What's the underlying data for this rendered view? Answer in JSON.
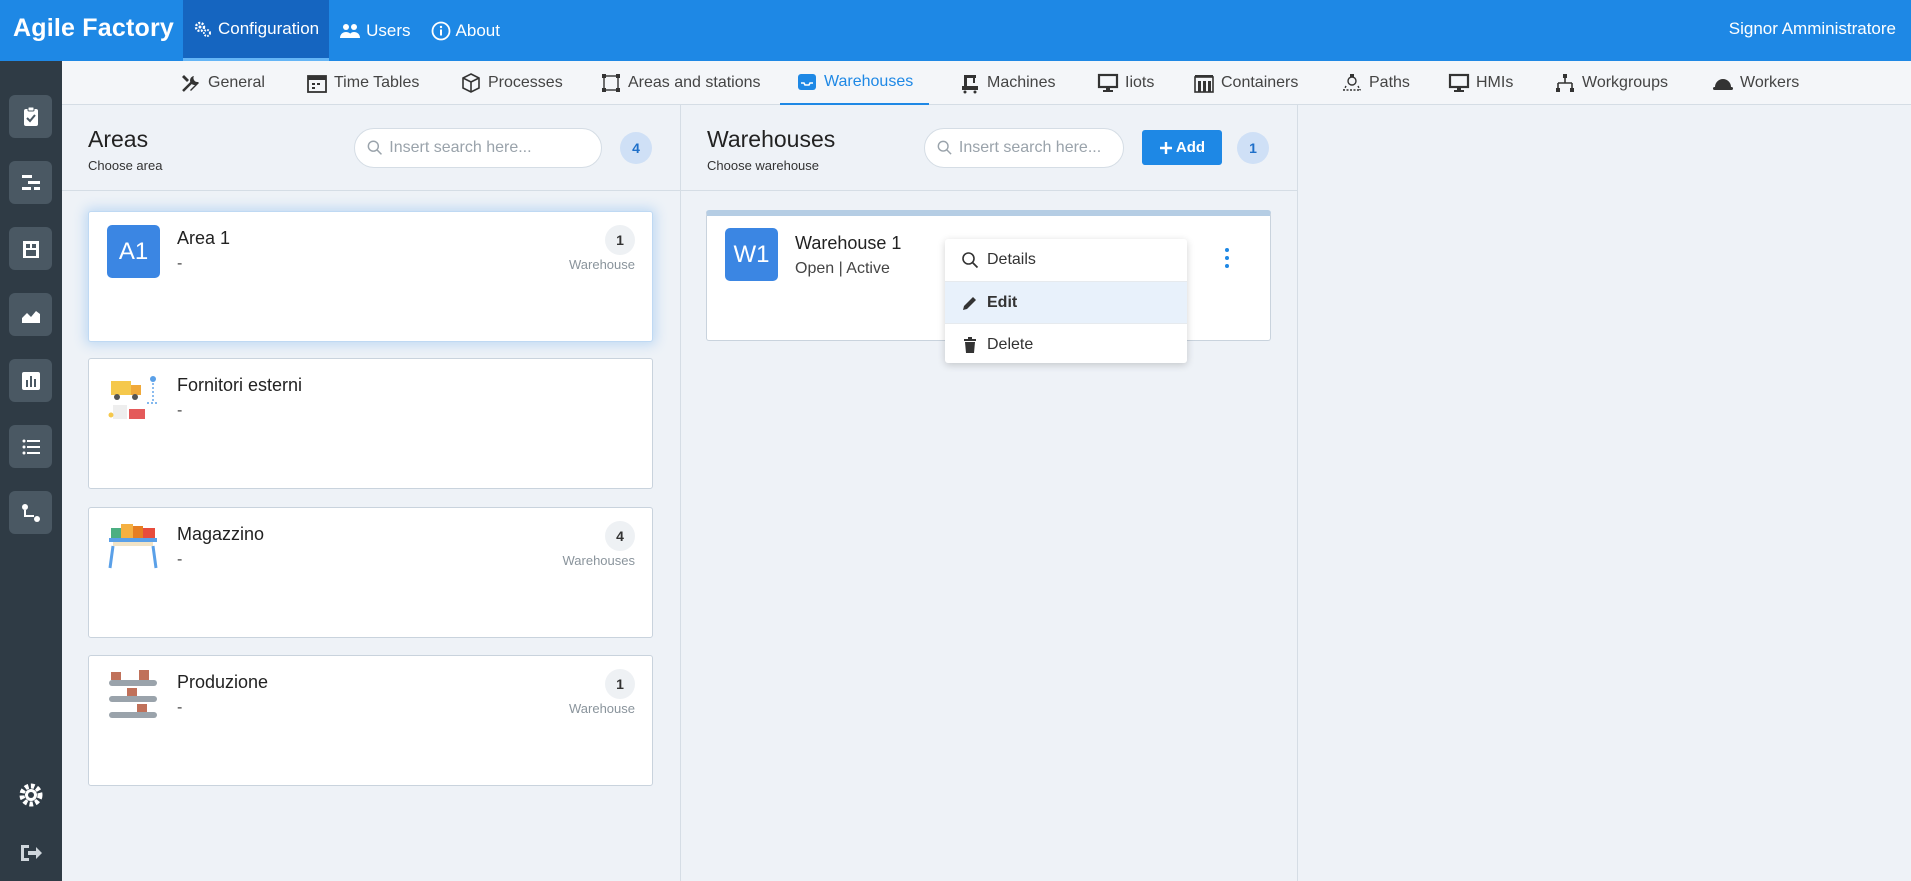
{
  "app": {
    "title": "Agile Factory",
    "user": "Signor Amministratore"
  },
  "topnav": [
    {
      "label": "Configuration",
      "icon": "gears-icon",
      "active": true
    },
    {
      "label": "Users",
      "icon": "users-icon"
    },
    {
      "label": "About",
      "icon": "info-icon"
    }
  ],
  "tabs": [
    {
      "label": "General",
      "icon": "tools-icon"
    },
    {
      "label": "Time Tables",
      "icon": "calendar-icon"
    },
    {
      "label": "Processes",
      "icon": "cube-icon"
    },
    {
      "label": "Areas and stations",
      "icon": "area-icon"
    },
    {
      "label": "Warehouses",
      "icon": "inbox-icon",
      "active": true
    },
    {
      "label": "Machines",
      "icon": "machine-icon"
    },
    {
      "label": "Iiots",
      "icon": "monitor-icon"
    },
    {
      "label": "Containers",
      "icon": "containers-icon"
    },
    {
      "label": "Paths",
      "icon": "path-icon"
    },
    {
      "label": "HMIs",
      "icon": "monitor-icon"
    },
    {
      "label": "Workgroups",
      "icon": "workgroup-icon"
    },
    {
      "label": "Workers",
      "icon": "helmet-icon"
    }
  ],
  "areas": {
    "title": "Areas",
    "subtitle": "Choose area",
    "search_placeholder": "Insert search here...",
    "count": "4",
    "items": [
      {
        "initials": "A1",
        "name": "Area 1",
        "desc": "-",
        "count": "1",
        "count_label": "Warehouse",
        "selected": true
      },
      {
        "name": "Fornitori esterni",
        "desc": "-",
        "illustration": "truck-illustration"
      },
      {
        "name": "Magazzino",
        "desc": "-",
        "count": "4",
        "count_label": "Warehouses",
        "illustration": "shelf-illustration"
      },
      {
        "name": "Produzione",
        "desc": "-",
        "count": "1",
        "count_label": "Warehouse",
        "illustration": "conveyor-illustration"
      }
    ]
  },
  "warehouses": {
    "title": "Warehouses",
    "subtitle": "Choose warehouse",
    "search_placeholder": "Insert search here...",
    "add_label": "Add",
    "count": "1",
    "items": [
      {
        "initials": "W1",
        "name": "Warehouse 1",
        "status": "Open | Active"
      }
    ]
  },
  "menu": {
    "items": [
      {
        "label": "Details",
        "icon": "search-icon"
      },
      {
        "label": "Edit",
        "icon": "pencil-icon",
        "hover": true
      },
      {
        "label": "Delete",
        "icon": "trash-icon"
      }
    ]
  },
  "colors": {
    "primary": "#1e88e5",
    "sidebar": "#2f3b45",
    "background": "#eef2f7"
  }
}
